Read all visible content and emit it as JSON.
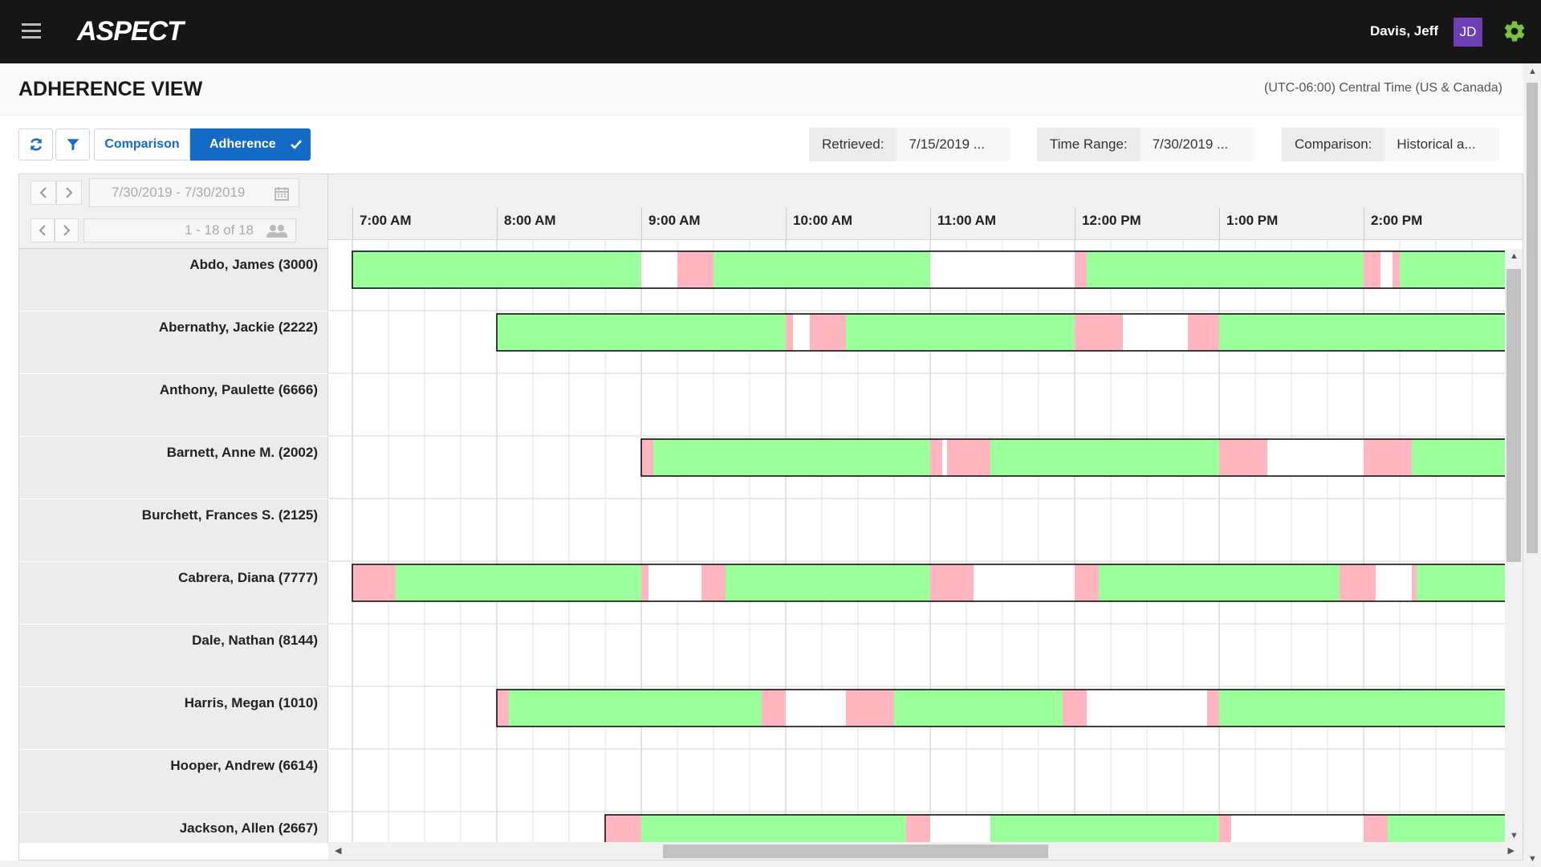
{
  "app": {
    "logo": "ASPECT",
    "user": "Davis, Jeff",
    "initials": "JD",
    "avatar_color": "#6e3fb3",
    "accent_color": "#1569c7",
    "gear_color": "#7cc242"
  },
  "header": {
    "title": "ADHERENCE VIEW",
    "timezone": "(UTC-06:00) Central Time (US & Canada)"
  },
  "toolbar": {
    "comparison_label": "Comparison",
    "adherence_label": "Adherence",
    "retrieved_label": "Retrieved:",
    "retrieved_value": "7/15/2019 ...",
    "time_range_label": "Time Range:",
    "time_range_value": "7/30/2019 ...",
    "comparison_pill_label": "Comparison:",
    "comparison_pill_value": "Historical a..."
  },
  "grid": {
    "date_range": "7/30/2019 - 7/30/2019",
    "agent_count": "1 - 18 of 18",
    "time_labels": [
      "7:00 AM",
      "8:00 AM",
      "9:00 AM",
      "10:00 AM",
      "11:00 AM",
      "12:00 PM",
      "1:00 PM",
      "2:00 PM"
    ],
    "colors": {
      "adherent": "#9bff9b",
      "out_of_adherence": "#ffb6c1",
      "scheduled_outline": "#000000"
    },
    "agents": [
      {
        "name": "Abdo, James (3000)",
        "schedule": [
          "7:00",
          "15:00"
        ],
        "segments": [
          [
            "7:00",
            "9:00",
            "g"
          ],
          [
            "9:15",
            "9:30",
            "r"
          ],
          [
            "9:30",
            "11:00",
            "g"
          ],
          [
            "12:00",
            "12:05",
            "r"
          ],
          [
            "12:05",
            "14:00",
            "g"
          ],
          [
            "14:00",
            "14:07",
            "r"
          ],
          [
            "14:12",
            "14:15",
            "r"
          ],
          [
            "14:15",
            "15:00",
            "g"
          ]
        ]
      },
      {
        "name": "Abernathy, Jackie (2222)",
        "schedule": [
          "8:00",
          "15:00"
        ],
        "segments": [
          [
            "8:00",
            "10:00",
            "g"
          ],
          [
            "10:00",
            "10:03",
            "r"
          ],
          [
            "10:10",
            "10:25",
            "r"
          ],
          [
            "10:25",
            "12:00",
            "g"
          ],
          [
            "12:00",
            "12:20",
            "r"
          ],
          [
            "12:47",
            "13:00",
            "r"
          ],
          [
            "13:00",
            "15:00",
            "g"
          ]
        ]
      },
      {
        "name": "Anthony, Paulette (6666)",
        "schedule": null,
        "segments": []
      },
      {
        "name": "Barnett, Anne M. (2002)",
        "schedule": [
          "9:00",
          "15:00"
        ],
        "segments": [
          [
            "9:00",
            "9:05",
            "r"
          ],
          [
            "9:05",
            "11:00",
            "g"
          ],
          [
            "11:00",
            "11:05",
            "r"
          ],
          [
            "11:07",
            "11:25",
            "r"
          ],
          [
            "11:25",
            "13:00",
            "g"
          ],
          [
            "13:00",
            "13:20",
            "r"
          ],
          [
            "14:00",
            "14:20",
            "r"
          ],
          [
            "14:20",
            "15:00",
            "g"
          ]
        ]
      },
      {
        "name": "Burchett, Frances S. (2125)",
        "schedule": null,
        "segments": []
      },
      {
        "name": "Cabrera, Diana (7777)",
        "schedule": [
          "7:00",
          "15:00"
        ],
        "segments": [
          [
            "7:00",
            "7:18",
            "r"
          ],
          [
            "7:18",
            "9:00",
            "g"
          ],
          [
            "9:00",
            "9:03",
            "r"
          ],
          [
            "9:25",
            "9:35",
            "r"
          ],
          [
            "9:35",
            "11:00",
            "g"
          ],
          [
            "11:00",
            "11:18",
            "r"
          ],
          [
            "12:00",
            "12:10",
            "r"
          ],
          [
            "12:10",
            "13:50",
            "g"
          ],
          [
            "13:50",
            "14:05",
            "r"
          ],
          [
            "14:20",
            "14:22",
            "r"
          ],
          [
            "14:22",
            "15:00",
            "g"
          ]
        ]
      },
      {
        "name": "Dale, Nathan (8144)",
        "schedule": null,
        "segments": []
      },
      {
        "name": "Harris, Megan (1010)",
        "schedule": [
          "8:00",
          "15:00"
        ],
        "segments": [
          [
            "8:00",
            "8:05",
            "r"
          ],
          [
            "8:05",
            "9:50",
            "g"
          ],
          [
            "9:50",
            "10:00",
            "r"
          ],
          [
            "10:25",
            "10:45",
            "r"
          ],
          [
            "10:45",
            "11:55",
            "g"
          ],
          [
            "11:55",
            "12:05",
            "r"
          ],
          [
            "12:55",
            "13:00",
            "r"
          ],
          [
            "13:00",
            "15:00",
            "g"
          ]
        ]
      },
      {
        "name": "Hooper, Andrew (6614)",
        "schedule": null,
        "segments": []
      },
      {
        "name": "Jackson, Allen (2667)",
        "schedule": [
          "8:45",
          "15:00"
        ],
        "segments": [
          [
            "8:45",
            "9:00",
            "r"
          ],
          [
            "9:00",
            "10:50",
            "g"
          ],
          [
            "10:50",
            "11:00",
            "r"
          ],
          [
            "11:25",
            "13:00",
            "g"
          ],
          [
            "13:00",
            "13:05",
            "r"
          ],
          [
            "14:00",
            "14:10",
            "r"
          ],
          [
            "14:10",
            "15:00",
            "g"
          ]
        ]
      }
    ]
  }
}
